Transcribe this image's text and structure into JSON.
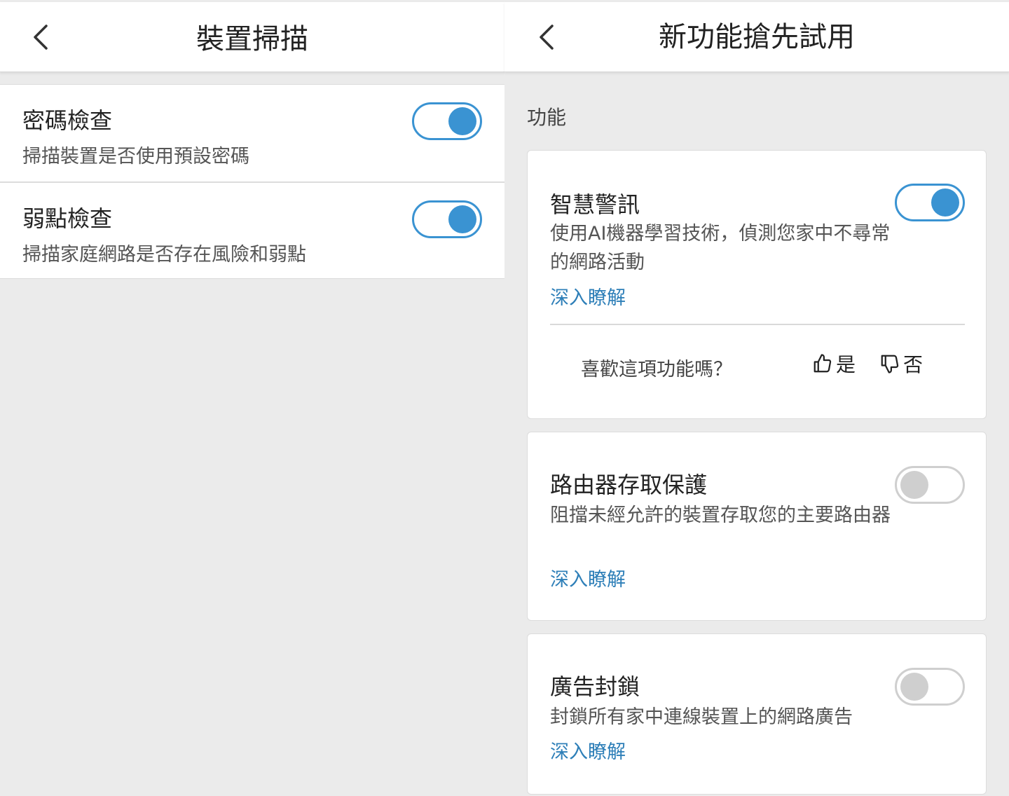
{
  "accent_color": "#d71920",
  "toggle_on_color": "#3a93d2",
  "link_color": "#2e7fb8",
  "left": {
    "back_icon": "chevron-left-icon",
    "title": "裝置掃描",
    "items": [
      {
        "title": "密碼檢查",
        "desc": "掃描裝置是否使用預設密碼",
        "enabled": true
      },
      {
        "title": "弱點檢查",
        "desc": "掃描家庭網路是否存在風險和弱點",
        "enabled": true
      }
    ]
  },
  "right": {
    "back_icon": "chevron-left-icon",
    "title": "新功能搶先試用",
    "section_label": "功能",
    "features": [
      {
        "title": "智慧警訊",
        "desc": "使用AI機器學習技術，偵測您家中不尋常的網路活動",
        "link": "深入瞭解",
        "enabled": true,
        "feedback": {
          "question": "喜歡這項功能嗎？",
          "yes": "是",
          "no": "否"
        }
      },
      {
        "title": "路由器存取保護",
        "desc": "阻擋未經允許的裝置存取您的主要路由器",
        "link": "深入瞭解",
        "enabled": false
      },
      {
        "title": "廣告封鎖",
        "desc": "封鎖所有家中連線裝置上的網路廣告",
        "link": "深入瞭解",
        "enabled": false
      }
    ]
  }
}
